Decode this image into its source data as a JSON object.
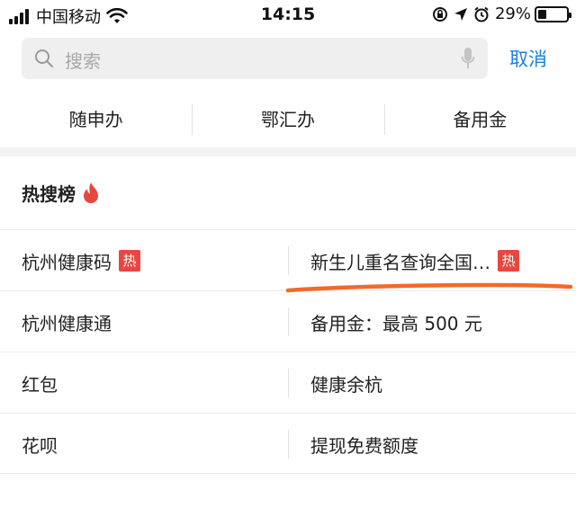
{
  "status_bar": {
    "carrier": "中国移动",
    "time": "14:15",
    "battery": "29%",
    "battery_level": 0.29,
    "icons": [
      "signal-icon",
      "wifi-icon",
      "rotation-lock-icon",
      "location-icon",
      "alarm-icon",
      "battery-icon"
    ]
  },
  "search": {
    "placeholder": "搜索",
    "cancel_label": "取消",
    "icons": [
      "search-icon",
      "microphone-icon"
    ]
  },
  "tabs": [
    {
      "label": "随申办"
    },
    {
      "label": "鄂汇办"
    },
    {
      "label": "备用金"
    }
  ],
  "hot_list": {
    "title": "热搜榜",
    "title_icon": "flame-icon",
    "badge_label": "热",
    "badge_color": "#e8473f",
    "rows": [
      {
        "left": "杭州健康码",
        "left_hot": true,
        "right": "新生儿重名查询全国…",
        "right_hot": true
      },
      {
        "left": "杭州健康通",
        "left_hot": false,
        "right": "备用金：最高 500 元",
        "right_hot": false
      },
      {
        "left": "红包",
        "left_hot": false,
        "right": "健康余杭",
        "right_hot": false
      },
      {
        "left": "花呗",
        "left_hot": false,
        "right": "提现免费额度",
        "right_hot": false
      }
    ]
  },
  "colors": {
    "accent": "#1a7fe6",
    "hot_red": "#e8473f",
    "annotation_orange": "#f06a2c"
  }
}
